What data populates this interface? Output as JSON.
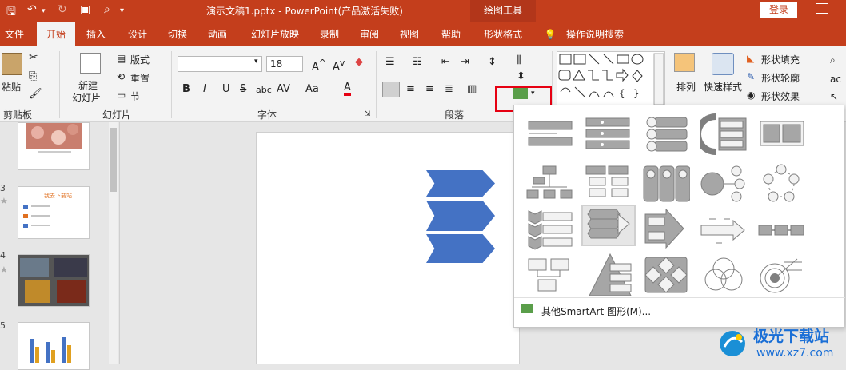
{
  "title_bar": {
    "doc_title": "演示文稿1.pptx - PowerPoint(产品激活失败)",
    "context_tool": "绘图工具",
    "login": "登录"
  },
  "tabs": [
    "文件",
    "开始",
    "插入",
    "设计",
    "切换",
    "动画",
    "幻灯片放映",
    "录制",
    "审阅",
    "视图",
    "帮助",
    "形状格式"
  ],
  "active_tab": "开始",
  "tell_me": "操作说明搜索",
  "ribbon": {
    "clipboard": {
      "label": "剪贴板",
      "paste": "粘贴"
    },
    "slides": {
      "label": "幻灯片",
      "new_slide_1": "新建",
      "new_slide_2": "幻灯片",
      "layout": "版式",
      "reset": "重置",
      "section": "节"
    },
    "font": {
      "label": "字体",
      "font_size": "18"
    },
    "paragraph": {
      "label": "段落"
    },
    "drawing": {
      "arrange": "排列",
      "quick_styles": "快速样式",
      "shape_fill": "形状填充",
      "shape_outline": "形状轮廓",
      "shape_effects": "形状效果"
    }
  },
  "slide_numbers": [
    "3",
    "4",
    "5"
  ],
  "thumbnail_slide3_title": "我去下载站",
  "smartart_more": "其他SmartArt 图形(M)...",
  "watermark": {
    "brand": "极光下载站",
    "url": "www.xz7.com"
  },
  "colors": {
    "accent": "#c43e1c",
    "chevron": "#4472c4",
    "highlight_box": "#e60012"
  }
}
